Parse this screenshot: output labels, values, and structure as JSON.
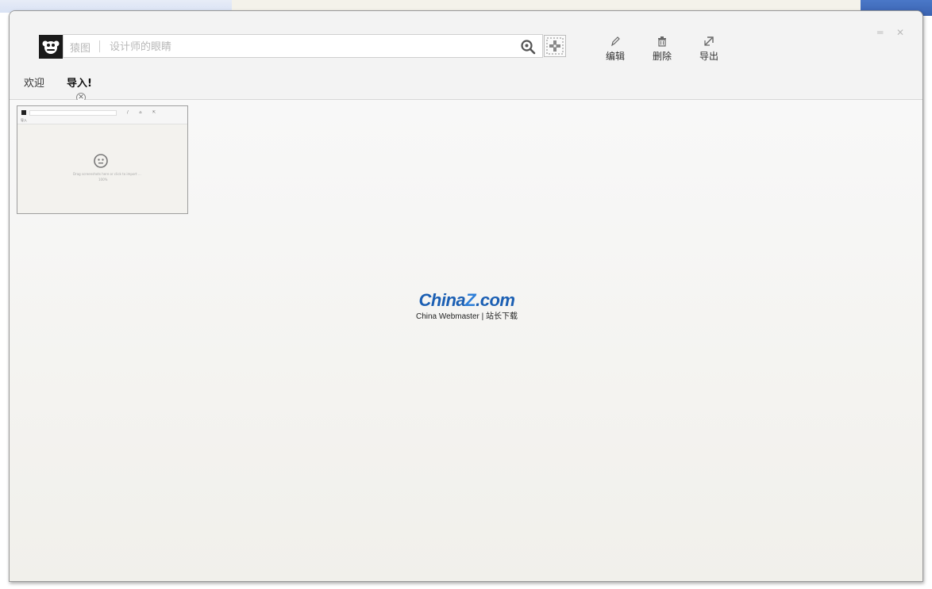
{
  "app": {
    "brand": "猿图",
    "window_controls": {
      "minimize": "═",
      "close": "✕"
    }
  },
  "search": {
    "value": "",
    "placeholder": "设计师的眼睛"
  },
  "toolbar": {
    "edit_label": "编辑",
    "delete_label": "删除",
    "export_label": "导出"
  },
  "tabs": [
    {
      "label": "欢迎",
      "active": false
    },
    {
      "label": "导入!",
      "active": true
    }
  ],
  "tab_close_glyph": "✕",
  "thumbnail": {
    "tools_text": "/ ⌂ ⇱",
    "tab_text": "导入",
    "line1": "Drag screenshots here or click to import ...",
    "line2": "100%"
  },
  "watermark": {
    "logo_part1": "China",
    "logo_part2": "Z",
    "logo_part3": ".com",
    "subtitle": "China Webmaster | 站长下载"
  },
  "colors": {
    "accent": "#1b5fb3",
    "header_bg": "#f3f3f3",
    "content_bg": "#f6f6f4"
  },
  "icons": [
    "monkey-logo-icon",
    "search-icon",
    "capture-icon",
    "edit-icon",
    "trash-icon",
    "export-icon",
    "minimize-icon",
    "close-icon"
  ]
}
